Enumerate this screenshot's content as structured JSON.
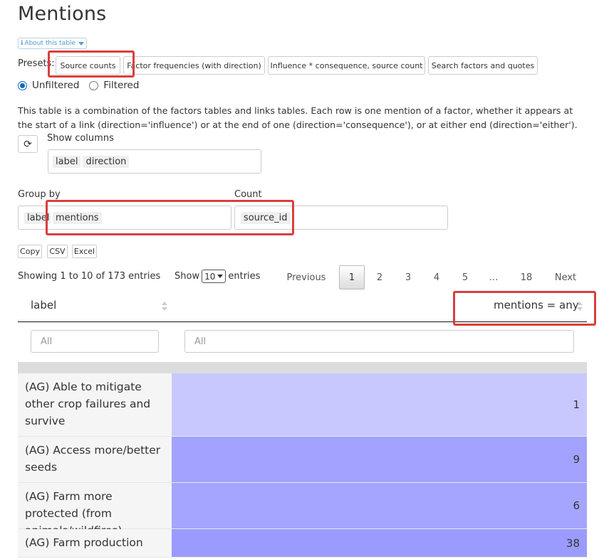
{
  "page": {
    "title": "Mentions"
  },
  "about": {
    "label": "About this table"
  },
  "presets": {
    "label": "Presets:",
    "buttons": [
      "Source counts",
      "Factor frequencies (with direction)",
      "Influence * consequence, source count",
      "Search factors and quotes"
    ]
  },
  "filter_mode": {
    "options": [
      "Unfiltered",
      "Filtered"
    ],
    "selected": "Unfiltered"
  },
  "description": "This table is a combination of the factors tables and links tables. Each row is one mention of a factor, whether it appears at the start of a link (direction='influence') or at the end of one (direction='consequence'), or at either end (direction='either').",
  "show_columns": {
    "label": "Show columns",
    "chips": [
      "label",
      "direction"
    ]
  },
  "group_by": {
    "label": "Group by",
    "chips": [
      "label",
      "mentions"
    ]
  },
  "count": {
    "label": "Count",
    "chips": [
      "source_id"
    ]
  },
  "export_buttons": [
    "Copy",
    "CSV",
    "Excel"
  ],
  "table_info": "Showing 1 to 10 of 173 entries",
  "length": {
    "show": "Show",
    "value": "10",
    "entries": "entries"
  },
  "pagination": {
    "previous": "Previous",
    "pages": [
      "1",
      "2",
      "3",
      "4",
      "5",
      "…",
      "18"
    ],
    "current": "1",
    "next": "Next"
  },
  "columns": [
    "label",
    "mentions = any"
  ],
  "filters": {
    "placeholder_label": "All",
    "placeholder_value": "All"
  },
  "rows": [
    {
      "label": "(AG) Able to mitigate other crop failures and survive",
      "value": "1",
      "color": "#c8c8ff"
    },
    {
      "label": "(AG) Access more/better seeds",
      "value": "9",
      "color": "#a3a3ff"
    },
    {
      "label": "(AG) Farm more protected (from animals/wildfires)",
      "value": "6",
      "color": "#a5a5ff"
    },
    {
      "label": "(AG) Farm production",
      "value": "38",
      "color": "#9b9bff"
    }
  ],
  "colors": {
    "highlight": "#d93f3f",
    "accent": "#1565c0"
  }
}
